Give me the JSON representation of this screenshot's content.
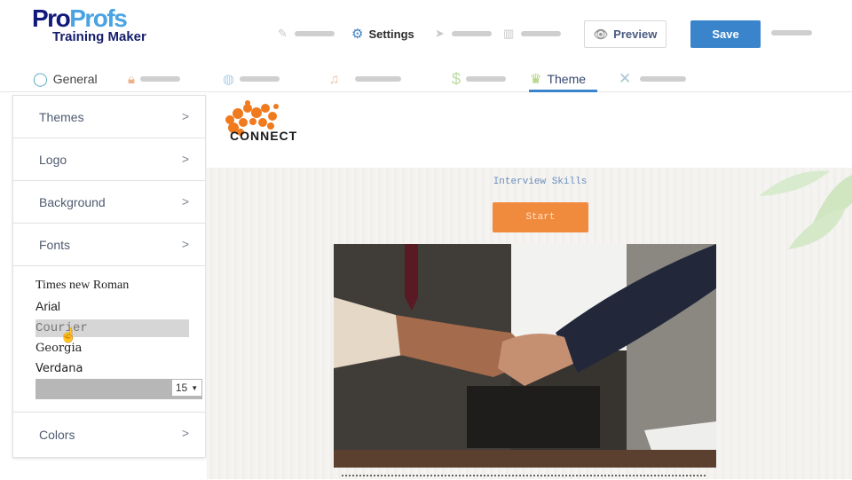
{
  "header": {
    "logo": {
      "line1_part1": "Pro",
      "line1_part2": "Profs",
      "line2": "Training Maker"
    },
    "steps": [
      {
        "icon": "pencil-icon",
        "label": ""
      },
      {
        "icon": "gear-icon",
        "label": "Settings",
        "active": true
      },
      {
        "icon": "paper-plane-icon",
        "label": ""
      },
      {
        "icon": "bar-chart-icon",
        "label": ""
      }
    ],
    "preview_label": "Preview",
    "save_label": "Save",
    "colors": {
      "accent": "#3a84cc"
    }
  },
  "tabs": [
    {
      "icon": "check-circle-icon",
      "label": "General"
    },
    {
      "icon": "lock-icon",
      "label": ""
    },
    {
      "icon": "globe-icon",
      "label": ""
    },
    {
      "icon": "bell-icon",
      "label": ""
    },
    {
      "icon": "dollar-icon",
      "label": ""
    },
    {
      "icon": "theme-brush-icon",
      "label": "Theme",
      "active": true
    },
    {
      "icon": "tools-icon",
      "label": ""
    }
  ],
  "sidebar": {
    "items": [
      {
        "label": "Themes"
      },
      {
        "label": "Logo"
      },
      {
        "label": "Background"
      },
      {
        "label": "Fonts"
      }
    ],
    "fonts": {
      "options": [
        "Times new Roman",
        "Arial",
        "Courier",
        "Georgia",
        "Verdana"
      ],
      "selected": "Courier",
      "size": "15"
    },
    "colors_label": "Colors"
  },
  "preview": {
    "brand_name": "CONNECT",
    "course_title": "Interview Skills",
    "start_label": "Start",
    "start_color": "#f08a3c"
  }
}
